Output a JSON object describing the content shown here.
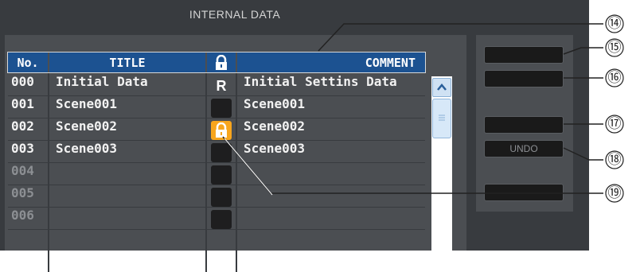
{
  "window": {
    "title": "INTERNAL DATA"
  },
  "table": {
    "headers": {
      "no": "No.",
      "title": "TITLE",
      "lock_icon": "lock-icon",
      "comment": "COMMENT"
    },
    "rows": [
      {
        "no": "000",
        "title": "Initial Data",
        "lock": "R",
        "comment": "Initial Settins Data"
      },
      {
        "no": "001",
        "title": "Scene001",
        "lock": "",
        "comment": "Scene001"
      },
      {
        "no": "002",
        "title": "Scene002",
        "lock": "locked",
        "comment": "Scene002"
      },
      {
        "no": "003",
        "title": "Scene003",
        "lock": "",
        "comment": "Scene003"
      },
      {
        "no": "004",
        "title": "",
        "lock": "",
        "comment": ""
      },
      {
        "no": "005",
        "title": "",
        "lock": "",
        "comment": ""
      },
      {
        "no": "006",
        "title": "",
        "lock": "",
        "comment": ""
      }
    ]
  },
  "side_buttons": [
    {
      "label": ""
    },
    {
      "label": ""
    },
    {
      "label": ""
    },
    {
      "label": "UNDO"
    },
    {
      "label": ""
    }
  ],
  "callouts": [
    "⑭",
    "⑮",
    "⑯",
    "⑰",
    "⑱",
    "⑲"
  ],
  "colors": {
    "panel": "#383b3f",
    "header": "#1c5291",
    "lock_accent": "#f7a51d"
  }
}
